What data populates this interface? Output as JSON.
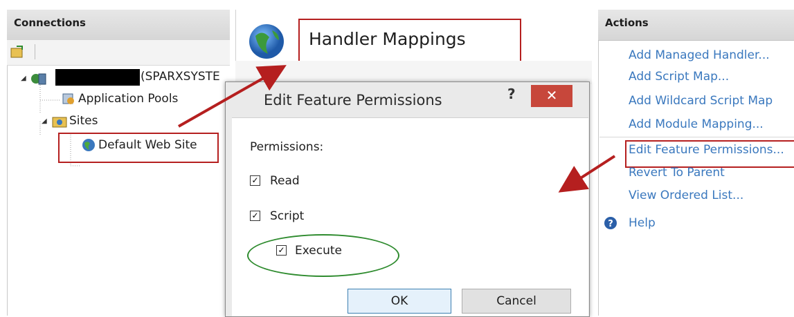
{
  "connections": {
    "title": "Connections",
    "server_suffix": "(SPARXSYSTE",
    "app_pools": "Application Pools",
    "sites": "Sites",
    "default_site": "Default Web Site"
  },
  "main": {
    "title": "Handler Mappings"
  },
  "actions": {
    "title": "Actions",
    "items": [
      "Add Managed Handler...",
      "Add Script Map...",
      "Add Wildcard Script Map",
      "Add Module Mapping...",
      "Edit Feature Permissions...",
      "Revert To Parent",
      "View Ordered List...",
      "Help"
    ]
  },
  "dialog": {
    "title": "Edit Feature Permissions",
    "help_glyph": "?",
    "close_glyph": "✕",
    "permissions_label": "Permissions:",
    "read_label": "Read",
    "script_label": "Script",
    "execute_label": "Execute",
    "read_checked": true,
    "script_checked": true,
    "execute_checked": true,
    "ok": "OK",
    "cancel": "Cancel"
  },
  "colors": {
    "link": "#3a78be",
    "annotation_red": "#b51f1f",
    "annotation_green": "#2e8b2e",
    "close_button": "#c7473b"
  }
}
